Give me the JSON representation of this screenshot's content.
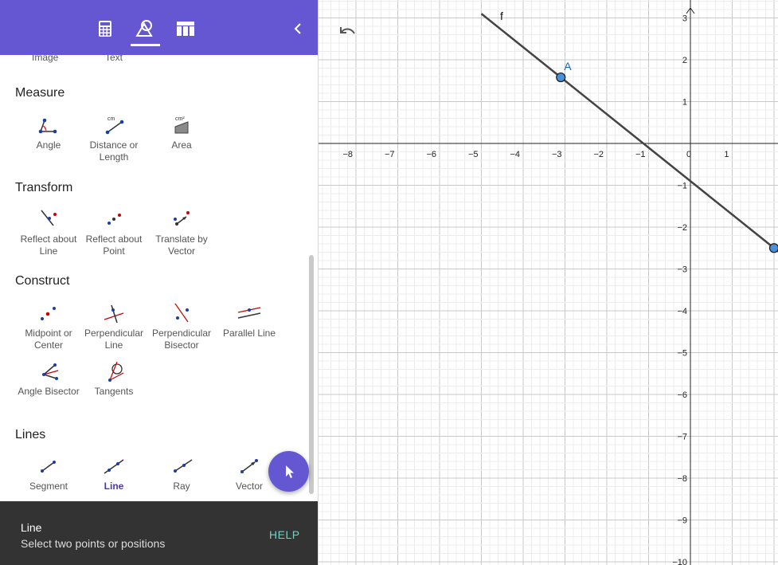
{
  "toolbar": {
    "icons": [
      "calculator-icon",
      "tools-icon",
      "table-icon"
    ],
    "active_tab": "tools",
    "collapse_icon": "chevron-left-icon",
    "accent": "#6557d2"
  },
  "clipped_labels": [
    "Image",
    "Text"
  ],
  "sections": [
    {
      "title": "Measure",
      "tools": [
        {
          "label": "Angle",
          "label2": "",
          "icon": "angle-icon"
        },
        {
          "label": "Distance or",
          "label2": "Length",
          "icon": "distance-icon"
        },
        {
          "label": "Area",
          "label2": "",
          "icon": "area-icon"
        }
      ]
    },
    {
      "title": "Transform",
      "tools": [
        {
          "label": "Reflect about",
          "label2": "Line",
          "icon": "reflect-line-icon"
        },
        {
          "label": "Reflect about",
          "label2": "Point",
          "icon": "reflect-point-icon"
        },
        {
          "label": "Translate by",
          "label2": "Vector",
          "icon": "translate-vector-icon"
        }
      ]
    },
    {
      "title": "Construct",
      "tools": [
        {
          "label": "Midpoint or",
          "label2": "Center",
          "icon": "midpoint-icon"
        },
        {
          "label": "Perpendicular",
          "label2": "Line",
          "icon": "perpendicular-line-icon"
        },
        {
          "label": "Perpendicular",
          "label2": "Bisector",
          "icon": "perpendicular-bisector-icon"
        },
        {
          "label": "Parallel Line",
          "label2": "",
          "icon": "parallel-line-icon"
        },
        {
          "label": "Angle Bisector",
          "label2": "",
          "icon": "angle-bisector-icon"
        },
        {
          "label": "Tangents",
          "label2": "",
          "icon": "tangents-icon"
        }
      ]
    },
    {
      "title": "Lines",
      "tools": [
        {
          "label": "Segment",
          "label2": "",
          "icon": "segment-icon"
        },
        {
          "label": "Line",
          "label2": "",
          "icon": "line-icon",
          "active": true
        },
        {
          "label": "Ray",
          "label2": "",
          "icon": "ray-icon"
        },
        {
          "label": "Vector",
          "label2": "",
          "icon": "vector-icon"
        }
      ]
    }
  ],
  "icon_text": {
    "cm": "cm",
    "cm2": "cm²"
  },
  "fab": {
    "icon": "cursor-icon"
  },
  "help": {
    "title": "Line",
    "description": "Select two points or positions",
    "button": "HELP"
  },
  "graph": {
    "undo_icon": "undo-icon",
    "x_ticks": [
      "−8",
      "−7",
      "−6",
      "−5",
      "−4",
      "−3",
      "−2",
      "−1",
      "0",
      "1"
    ],
    "y_ticks": [
      "3",
      "2",
      "1",
      "−1",
      "−2",
      "−3",
      "−4",
      "−5",
      "−6",
      "−7",
      "−8",
      "−9",
      "−10"
    ],
    "line_label": "f",
    "point_label": "A",
    "line_color": "#444444",
    "point_color": "#1565c0",
    "point_fill": "#4a90d9"
  }
}
